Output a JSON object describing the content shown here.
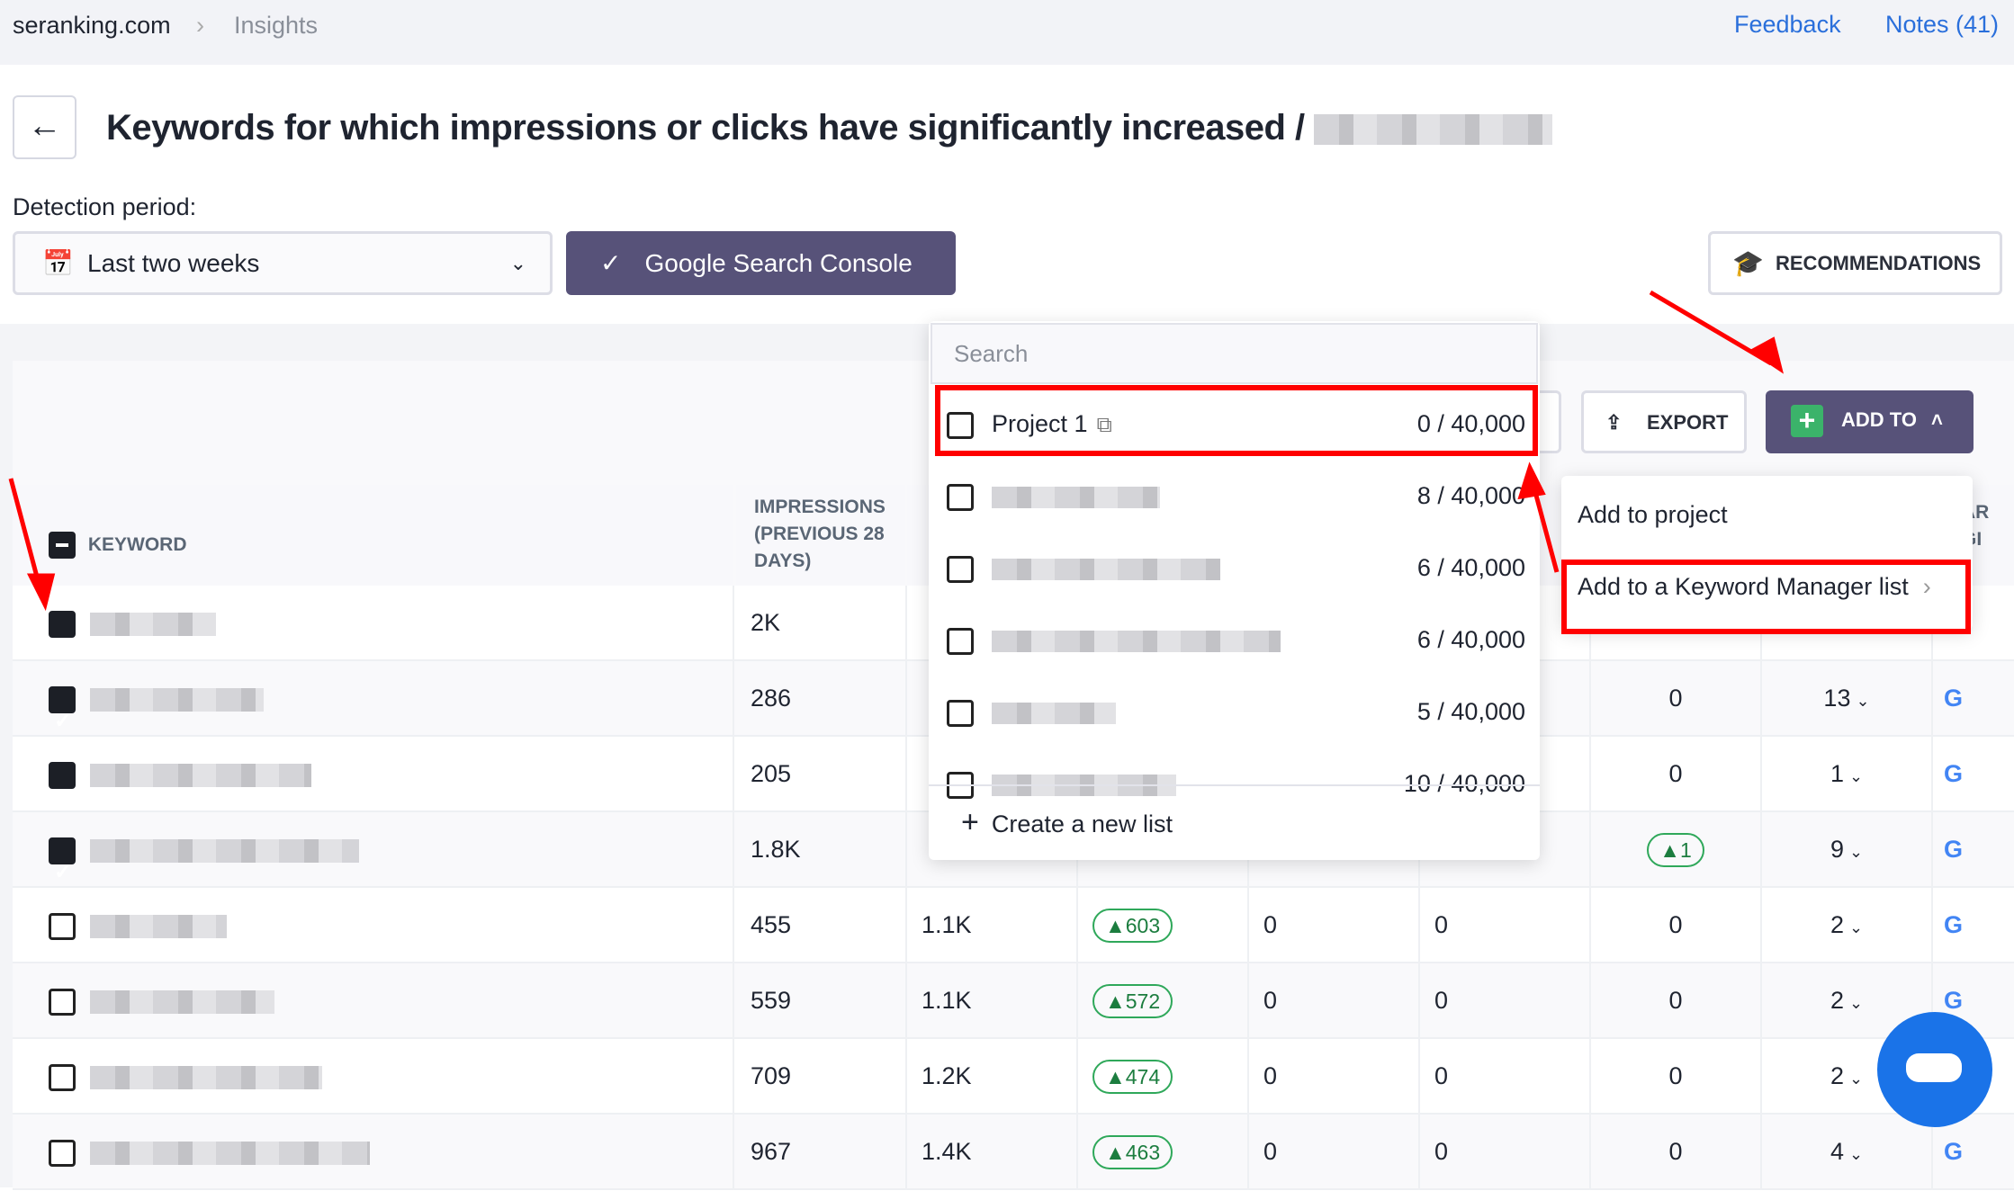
{
  "breadcrumb": {
    "site": "seranking.com",
    "section": "Insights"
  },
  "header_links": {
    "feedback": "Feedback",
    "notes": "Notes (41)"
  },
  "page_title": "Keywords for which impressions or clicks have significantly increased /",
  "detection": {
    "label": "Detection period:",
    "period": "Last two weeks",
    "source": "Google Search Console"
  },
  "recommendations": "RECOMMENDATIONS",
  "toolbar": {
    "export": "EXPORT",
    "add_to": "ADD TO"
  },
  "columns": {
    "keyword": "KEYWORD",
    "impressions_prev": "IMPRESSIONS (PREVIOUS 28 DAYS)"
  },
  "rows": [
    {
      "checked": true,
      "c1": "2K",
      "c2": "",
      "c3": "",
      "c4": "",
      "c5": "",
      "c6": "",
      "c7": ""
    },
    {
      "checked": true,
      "c1": "286",
      "c2": "",
      "c3": "",
      "c4": "",
      "c5": "",
      "c6": "0",
      "c7": "13"
    },
    {
      "checked": true,
      "c1": "205",
      "c2": "",
      "c3": "",
      "c4": "",
      "c5": "",
      "c6": "0",
      "c7": "1"
    },
    {
      "checked": true,
      "c1": "1.8K",
      "c2": "",
      "c3": "",
      "c4": "",
      "c5": "",
      "c6": "▲1",
      "c7": "9"
    },
    {
      "checked": false,
      "c1": "455",
      "c2": "1.1K",
      "c3": "▲603",
      "c4": "0",
      "c5": "0",
      "c6": "0",
      "c7": "2"
    },
    {
      "checked": false,
      "c1": "559",
      "c2": "1.1K",
      "c3": "▲572",
      "c4": "0",
      "c5": "0",
      "c6": "0",
      "c7": "2"
    },
    {
      "checked": false,
      "c1": "709",
      "c2": "1.2K",
      "c3": "▲474",
      "c4": "0",
      "c5": "0",
      "c6": "0",
      "c7": "2"
    },
    {
      "checked": false,
      "c1": "967",
      "c2": "1.4K",
      "c3": "▲463",
      "c4": "0",
      "c5": "0",
      "c6": "0",
      "c7": "4"
    }
  ],
  "list_popup": {
    "search_placeholder": "Search",
    "items": [
      {
        "name": "Project 1",
        "count": "0 / 40,000"
      },
      {
        "name": "",
        "count": "8 / 40,000"
      },
      {
        "name": "",
        "count": "6 / 40,000"
      },
      {
        "name": "",
        "count": "6 / 40,000"
      },
      {
        "name": "",
        "count": "5 / 40,000"
      },
      {
        "name": "",
        "count": "10 / 40,000"
      }
    ],
    "create": "Create a new list"
  },
  "add_menu": {
    "add_project": "Add to project",
    "add_km_list": "Add to a Keyword Manager list"
  },
  "colors": {
    "accent": "#575279",
    "highlight": "#ff0000",
    "badge": "#2fa85a"
  }
}
